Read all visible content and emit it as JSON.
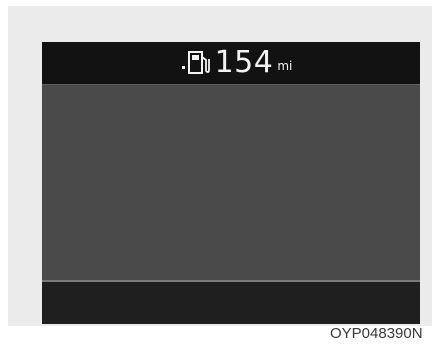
{
  "cluster": {
    "top_bar": {
      "range_value": "154",
      "range_unit": "mi",
      "icon": "fuel-pump-icon"
    }
  },
  "caption": {
    "image_code": "OYP048390N"
  },
  "colors": {
    "screen_bg": "#1c1c1c",
    "top_bar_bg": "#121212",
    "main_area_bg": "#4a4a4a",
    "text": "#f2f2f2",
    "frame_bg": "#ebebeb"
  }
}
